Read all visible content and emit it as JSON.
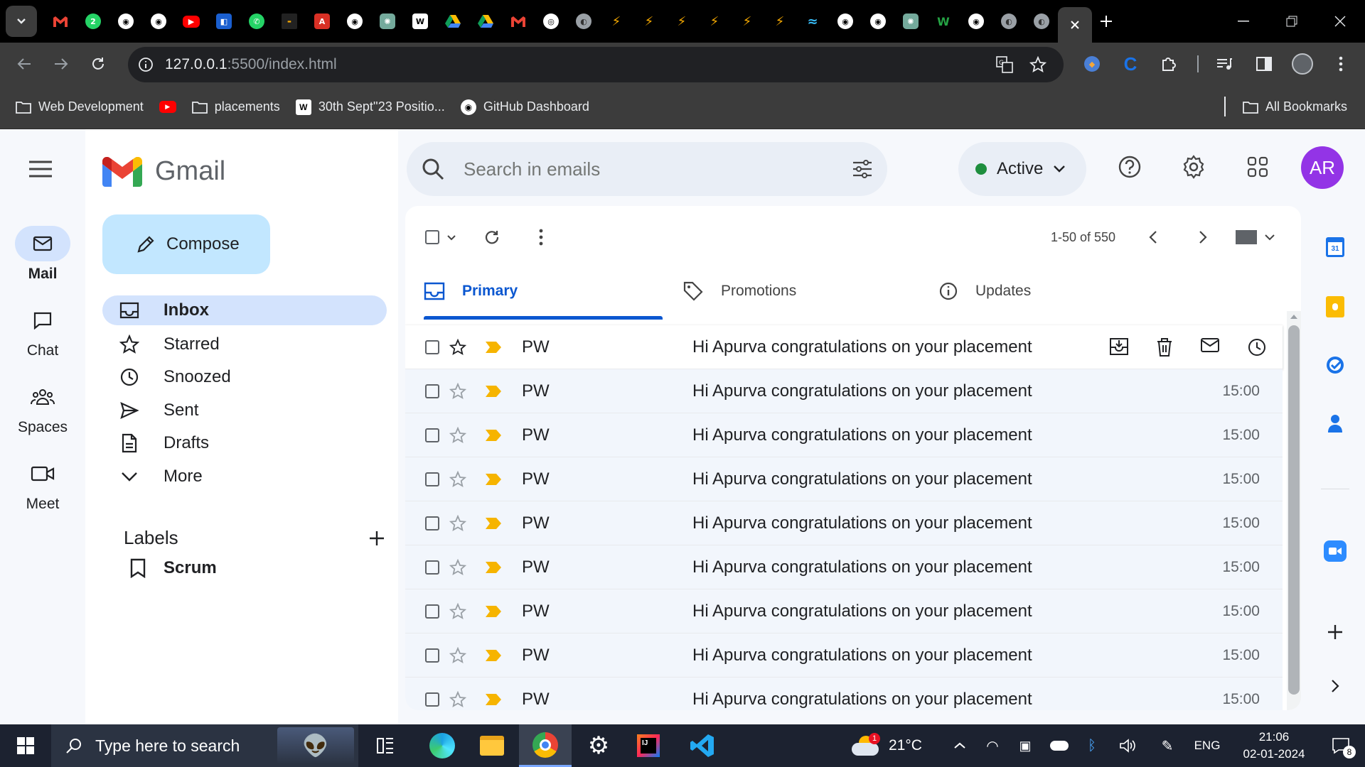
{
  "browser": {
    "url_host": "127.0.0.1",
    "url_path": ":5500/index.html",
    "bookmarks": [
      "Web Development",
      "placements",
      "30th Sept''23 Positio...",
      "GitHub Dashboard"
    ],
    "all_bookmarks": "All Bookmarks"
  },
  "gmail": {
    "logo_text": "Gmail",
    "compose": "Compose",
    "search_placeholder": "Search in emails",
    "status": "Active",
    "avatar": "AR",
    "rail": [
      "Mail",
      "Chat",
      "Spaces",
      "Meet"
    ],
    "nav": [
      "Inbox",
      "Starred",
      "Snoozed",
      "Sent",
      "Drafts",
      "More"
    ],
    "labels_title": "Labels",
    "labels": [
      "Scrum"
    ],
    "pagination": "1-50 of 550",
    "tabs": [
      "Primary",
      "Promotions",
      "Updates"
    ],
    "emails": [
      {
        "sender": "PW",
        "subject": "Hi Apurva congratulations on your placement",
        "time": ""
      },
      {
        "sender": "PW",
        "subject": "Hi Apurva congratulations on your placement",
        "time": "15:00"
      },
      {
        "sender": "PW",
        "subject": "Hi Apurva congratulations on your placement",
        "time": "15:00"
      },
      {
        "sender": "PW",
        "subject": "Hi Apurva congratulations on your placement",
        "time": "15:00"
      },
      {
        "sender": "PW",
        "subject": "Hi Apurva congratulations on your placement",
        "time": "15:00"
      },
      {
        "sender": "PW",
        "subject": "Hi Apurva congratulations on your placement",
        "time": "15:00"
      },
      {
        "sender": "PW",
        "subject": "Hi Apurva congratulations on your placement",
        "time": "15:00"
      },
      {
        "sender": "PW",
        "subject": "Hi Apurva congratulations on your placement",
        "time": "15:00"
      },
      {
        "sender": "PW",
        "subject": "Hi Apurva congratulations on your placement",
        "time": "15:00"
      }
    ]
  },
  "taskbar": {
    "search_placeholder": "Type here to search",
    "temperature": "21°C",
    "weather_badge": "1",
    "language": "ENG",
    "time": "21:06",
    "date": "02-01-2024",
    "notification_count": "8"
  },
  "colors": {
    "accent": "#0b57d0",
    "compose_bg": "#c2e7ff",
    "inbox_active": "#d3e3fd",
    "importance": "#f6b400",
    "avatar": "#9334e6"
  }
}
